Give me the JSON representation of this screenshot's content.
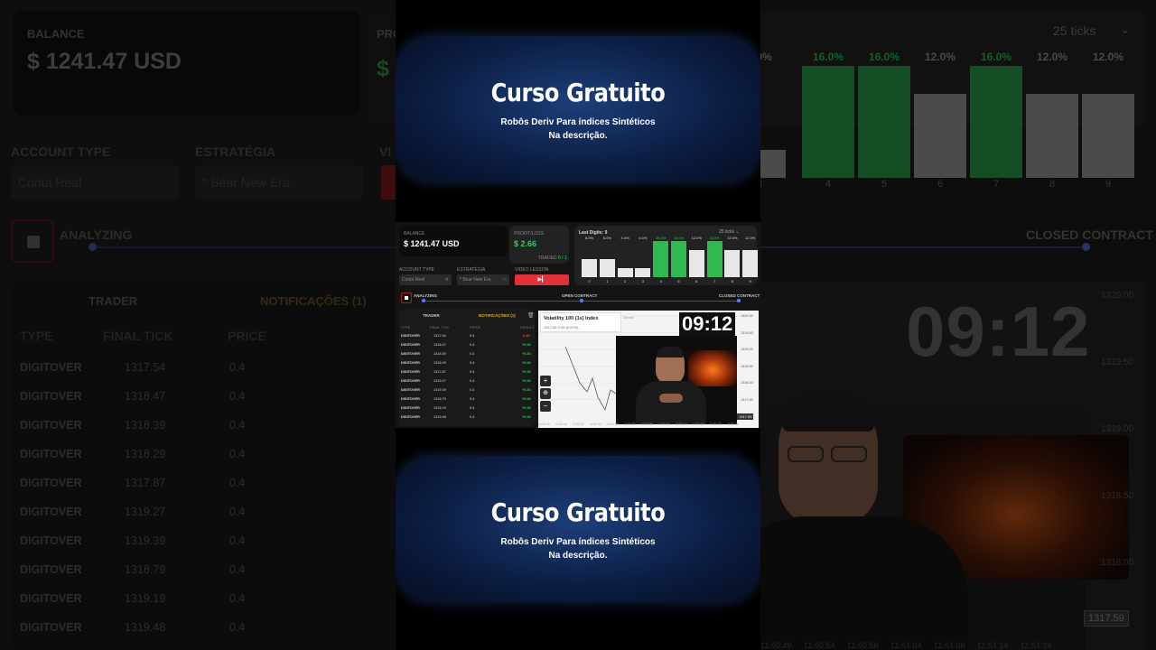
{
  "banner": {
    "title": "Curso Gratuito",
    "line1": "Robôs Deriv Para índices Sintéticos",
    "line2": "Na descrição."
  },
  "app": {
    "balance_label": "BALANCE",
    "balance_value": "$ 1241.47 USD",
    "profit_label": "PROFIT/LOSS",
    "profit_value": "$ 2.66",
    "traded_label": "TRADED",
    "traded_value": "8 / 1",
    "account_type_label": "ACCOUNT TYPE",
    "account_type_value": "Conta Real",
    "strategy_label": "ESTRATÉGIA",
    "strategy_value": "* Bear New Era",
    "video_label": "VIDEO LESSON",
    "status_analyzing": "ANALYZING",
    "status_open": "OPEN CONTRACT",
    "status_closed": "CLOSED CONTRACT",
    "tab_trader": "TRADER",
    "tab_notifications": "NOTIFICAÇÕES (1)",
    "tab_notifications_small": "NOTIFICAÇÕES (1)",
    "col_type": "TYPE",
    "col_final_tick": "FINAL TICK",
    "col_price": "PRICE",
    "col_result": "RESULT",
    "trades": [
      {
        "type": "DIGITOVER",
        "tick": "1317.54",
        "price": "0.4",
        "result": "-0.40"
      },
      {
        "type": "DIGITOVER",
        "tick": "1318.47",
        "price": "0.4",
        "result": "+0.34"
      },
      {
        "type": "DIGITOVER",
        "tick": "1318.39",
        "price": "0.4",
        "result": "+0.34"
      },
      {
        "type": "DIGITOVER",
        "tick": "1318.29",
        "price": "0.4",
        "result": "+0.34"
      },
      {
        "type": "DIGITOVER",
        "tick": "1317.87",
        "price": "0.4",
        "result": "+0.34"
      },
      {
        "type": "DIGITOVER",
        "tick": "1319.27",
        "price": "0.4",
        "result": "+0.34"
      },
      {
        "type": "DIGITOVER",
        "tick": "1319.39",
        "price": "0.4",
        "result": "+0.34"
      },
      {
        "type": "DIGITOVER",
        "tick": "1318.79",
        "price": "0.4",
        "result": "+0.34"
      },
      {
        "type": "DIGITOVER",
        "tick": "1319.19",
        "price": "0.4",
        "result": "+0.34"
      },
      {
        "type": "DIGITOVER",
        "tick": "1319.48",
        "price": "0.4",
        "result": "+0.34"
      }
    ],
    "last_digits_label": "Last Digits: 9",
    "ticks_select": "25 ticks",
    "digits": [
      {
        "digit": "0",
        "pct": "8.0%",
        "value": 8.0,
        "hot": false
      },
      {
        "digit": "1",
        "pct": "8.0%",
        "value": 8.0,
        "hot": false
      },
      {
        "digit": "2",
        "pct": "4.0%",
        "value": 4.0,
        "hot": false
      },
      {
        "digit": "3",
        "pct": "4.0%",
        "value": 4.0,
        "hot": false
      },
      {
        "digit": "4",
        "pct": "16.0%",
        "value": 16.0,
        "hot": true
      },
      {
        "digit": "5",
        "pct": "16.0%",
        "value": 16.0,
        "hot": true
      },
      {
        "digit": "6",
        "pct": "12.0%",
        "value": 12.0,
        "hot": false
      },
      {
        "digit": "7",
        "pct": "16.0%",
        "value": 16.0,
        "hot": true
      },
      {
        "digit": "8",
        "pct": "12.0%",
        "value": 12.0,
        "hot": false
      },
      {
        "digit": "9",
        "pct": "12.0%",
        "value": 12.0,
        "hot": false
      }
    ],
    "market_title": "Volatility 100 (1s) Index",
    "market_tag": "Derived",
    "market_quote": "1317.59  0.06 (0.00%)",
    "timer": "09:12",
    "price_axis": [
      "1320.00",
      "1319.50",
      "1319.00",
      "1318.50",
      "1318.00",
      "1317.50"
    ],
    "time_axis": [
      "11:50:42",
      "11:50:46",
      "11:50:50",
      "11:50:54",
      "11:50:58",
      "11:51:02",
      "11:51:06",
      "11:51:10",
      "11:51:14",
      "11:51:18",
      "11:51:22",
      "11:51:26"
    ],
    "current_price": "1317.59",
    "zoom_in": "+",
    "zoom_out": "−"
  },
  "background_right": {
    "ticks_select": "25 ticks",
    "status_closed": "CLOSED CONTRACT",
    "timer": "09:12",
    "price_axis": [
      "1320.00",
      "1319.50",
      "1319.00",
      "1318.50",
      "1318.00"
    ],
    "current_price": "1317.59",
    "time_axis": [
      "11:50:49",
      "11:50:54",
      "11:50:58",
      "11:51:04",
      "11:51:08",
      "11:51:14",
      "11:51:24"
    ]
  },
  "background_left": {
    "balance_label": "BALANCE",
    "balance_value": "$ 1241.47 USD",
    "profit_label": "PRO",
    "profit_value": "$",
    "account_type_label": "ACCOUNT TYPE",
    "account_type_value": "Conta Real",
    "strategy_label": "ESTRATÉGIA",
    "strategy_value": "* Bear New Era",
    "video_label": "VI",
    "status_analyzing": "ANALYZING",
    "tab_trader": "TRADER",
    "tab_notifications": "NOTIFICAÇÕES (1)",
    "col_type": "TYPE",
    "col_final_tick": "FINAL TICK",
    "col_price": "PRICE"
  }
}
